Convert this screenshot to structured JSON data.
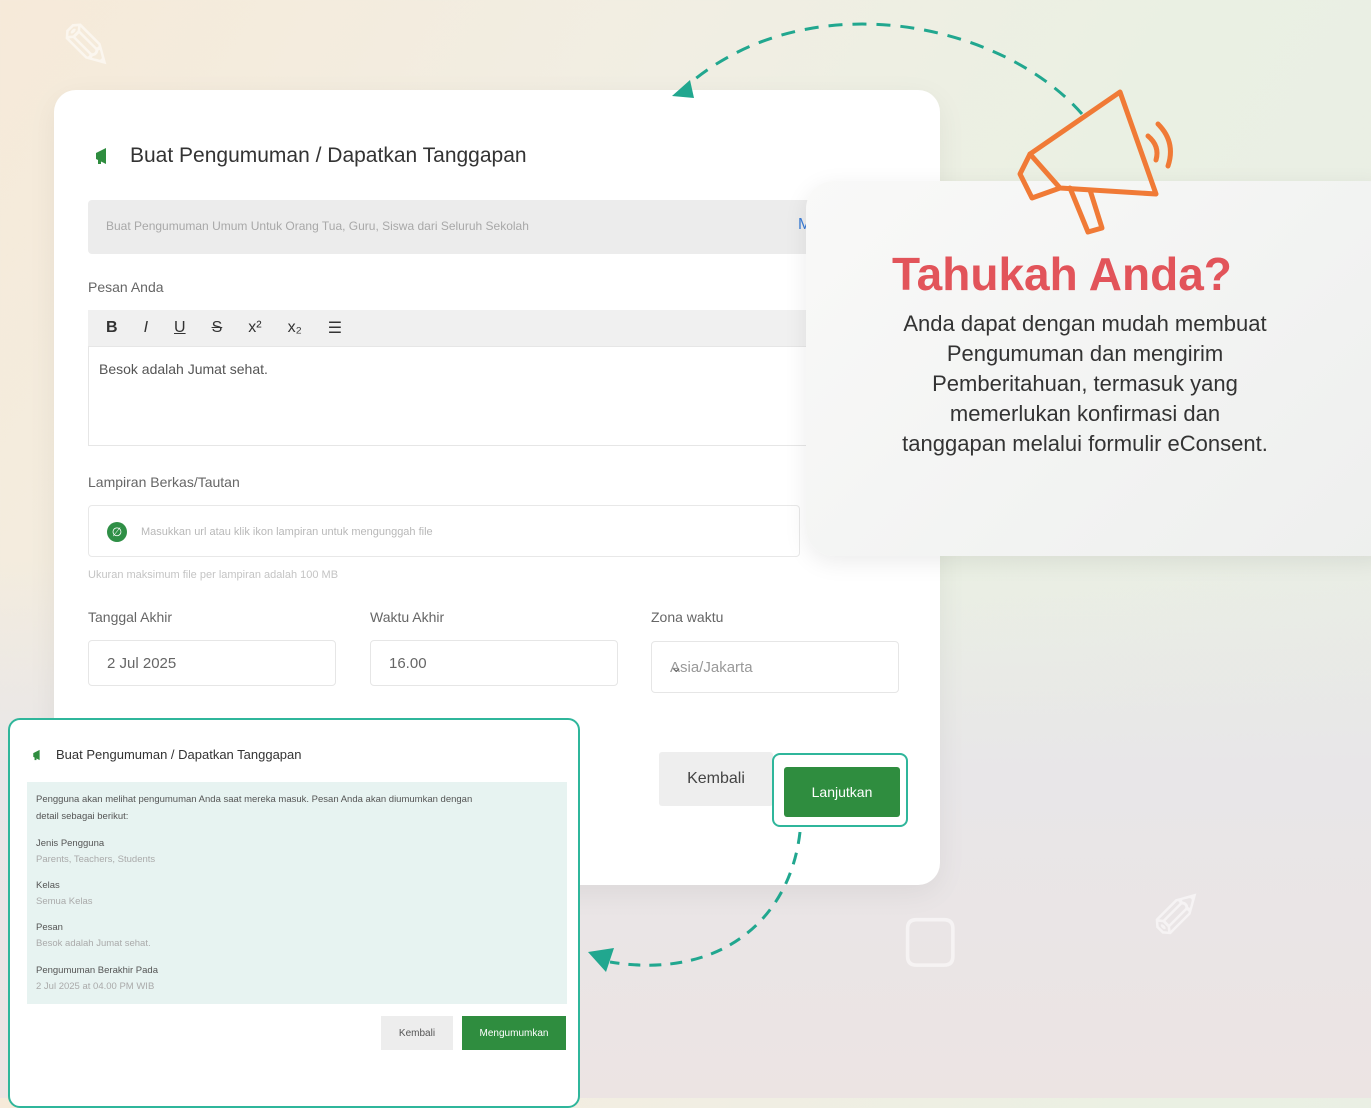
{
  "main_card": {
    "title": "Buat Pengumuman / Dapatkan Tanggapan",
    "info_text": "Buat Pengumuman Umum Untuk Orang Tua, Guru, Siswa dari Seluruh Sekolah",
    "info_more": "M",
    "message_label": "Pesan Anda",
    "toolbar": [
      "B",
      "I",
      "U",
      "S",
      "x²",
      "x₂",
      "☰"
    ],
    "message_value": "Besok adalah Jumat sehat.",
    "attachment_label": "Lampiran Berkas/Tautan",
    "attachment_placeholder": "Masukkan url atau klik ikon lampiran untuk mengunggah file",
    "attachment_hint": "Ukuran maksimum file per lampiran adalah 100 MB",
    "end_date_label": "Tanggal Akhir",
    "end_date_value": "2 Jul 2025",
    "end_time_label": "Waktu Akhir",
    "end_time_value": "16.00",
    "timezone_label": "Zona waktu",
    "timezone_value": "Asia/Jakarta",
    "back_label": "Kembali",
    "next_label": "Lanjutkan"
  },
  "tip": {
    "title": "Tahukah Anda?",
    "text": "Anda dapat dengan mudah membuat Pengumuman dan mengirim Pemberitahuan, termasuk yang memerlukan konfirmasi dan tanggapan melalui formulir eConsent."
  },
  "preview": {
    "title": "Buat Pengumuman / Dapatkan Tanggapan",
    "intro": "Pengguna akan melihat pengumuman Anda saat mereka masuk. Pesan Anda akan diumumkan dengan",
    "intro2": "detail sebagai berikut:",
    "user_type_label": "Jenis Pengguna",
    "user_type_value": "Parents, Teachers, Students",
    "class_label": "Kelas",
    "class_value": "Semua Kelas",
    "message_label": "Pesan",
    "message_value": "Besok adalah Jumat sehat.",
    "ends_label": "Pengumuman Berakhir Pada",
    "ends_value": "2 Jul 2025 at 04.00 PM WIB",
    "back_label": "Kembali",
    "announce_label": "Mengumumkan"
  },
  "colors": {
    "accent_green": "#2f8d3f",
    "teal_outline": "#2fb69b",
    "tip_title": "#e2545a",
    "megaphone_orange": "#f07a36"
  }
}
